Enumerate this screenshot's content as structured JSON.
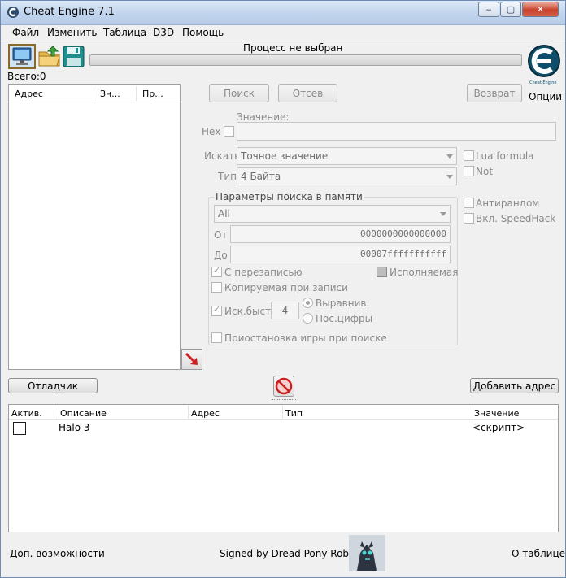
{
  "window": {
    "title": "Cheat Engine 7.1",
    "controls": {
      "minimize": "‒",
      "maximize": "▢",
      "close": "✕"
    }
  },
  "menu": [
    "Файл",
    "Изменить",
    "Таблица",
    "D3D",
    "Помощь"
  ],
  "toolbar": {
    "process_label": "Процесс не выбран",
    "options_label": "Опции",
    "logo_text": "Cheat Engine"
  },
  "results": {
    "count_label": "Всего:0",
    "columns": [
      "Адрес",
      "Зн...",
      "Пр..."
    ]
  },
  "scan": {
    "first_scan": "Поиск",
    "next_scan": "Отсев",
    "undo_scan": "Возврат",
    "value_label": "Значение:",
    "hex_label": "Hex",
    "scan_type_label": "Искать",
    "scan_type_value": "Точное значение",
    "value_type_label": "Тип",
    "value_type_value": "4 Байта",
    "lua_formula": "Lua formula",
    "not_label": "Not",
    "antirandom": "Антирандом",
    "speedhack": "Вкл. SpeedHack"
  },
  "memory": {
    "group_title": "Параметры поиска в памяти",
    "region_value": "All",
    "from_label": "От",
    "from_value": "0000000000000000",
    "to_label": "До",
    "to_value": "00007fffffffffff",
    "writable": "С перезаписью",
    "executable": "Исполняемая",
    "copy_on_write": "Копируемая при записи",
    "fast_scan": "Иск.быст.",
    "fast_scan_value": "4",
    "align": "Выравнив.",
    "last_digits": "Пос.цифры",
    "pause_game": "Приостановка игры при поиске"
  },
  "actions": {
    "memory_view": "Отладчик",
    "add_address": "Добавить адрес"
  },
  "table": {
    "columns": [
      "Актив.",
      "Описание",
      "Адрес",
      "Тип",
      "Значение"
    ],
    "rows": [
      {
        "active": false,
        "description": "Halo 3",
        "address": "",
        "type": "",
        "value": "<скрипт>"
      }
    ]
  },
  "status": {
    "advanced": "Доп. возможности",
    "signed": "Signed by Dread Pony Roberts",
    "about_table": "О таблице"
  }
}
